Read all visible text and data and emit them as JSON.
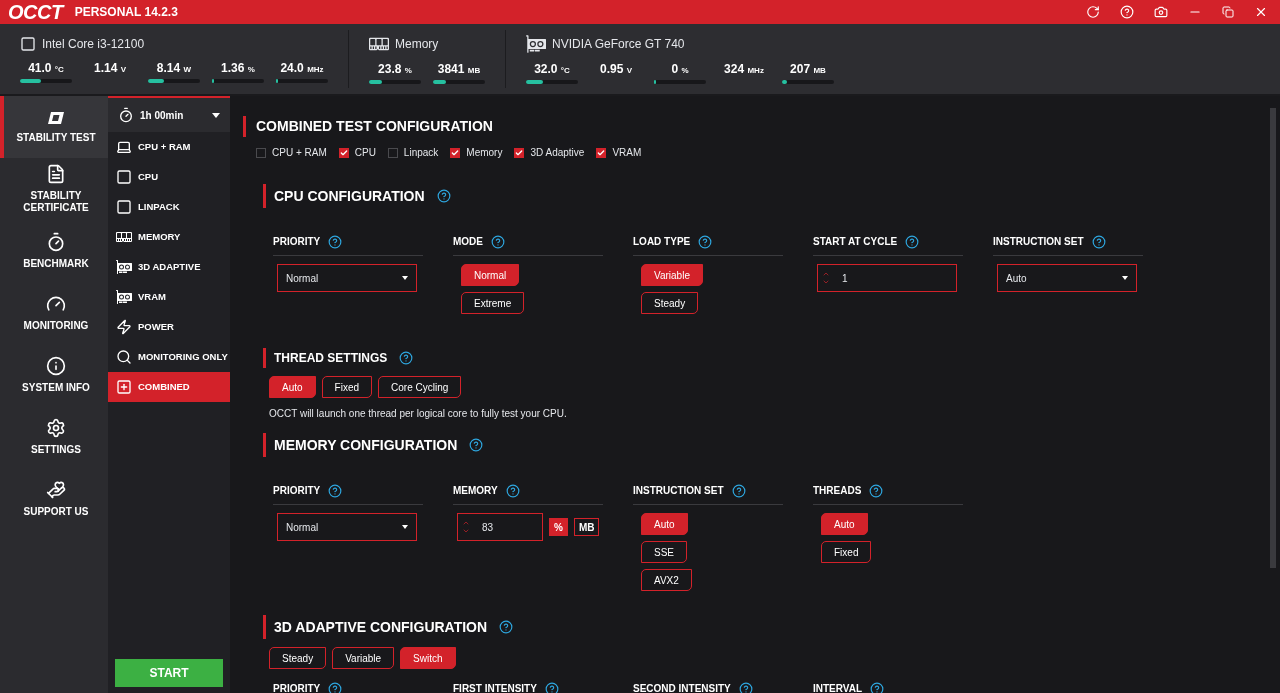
{
  "app": {
    "logo": "OCCT",
    "edition": "PERSONAL 14.2.3"
  },
  "monitors": [
    {
      "kind": "cpu",
      "name": "Intel Core i3-12100",
      "readings": [
        {
          "value": "41.0",
          "unit": "°C",
          "level": 0.41
        },
        {
          "value": "1.14",
          "unit": "V"
        },
        {
          "value": "8.14",
          "unit": "W",
          "level": 0.3
        },
        {
          "value": "1.36",
          "unit": "%",
          "level": 0.03
        },
        {
          "value": "24.0",
          "unit": "MHz",
          "level": 0.02
        }
      ]
    },
    {
      "kind": "memory",
      "name": "Memory",
      "readings": [
        {
          "value": "23.8",
          "unit": "%",
          "level": 0.25
        },
        {
          "value": "3841",
          "unit": "MB",
          "level": 0.25
        }
      ]
    },
    {
      "kind": "gpu",
      "name": "NVIDIA GeForce GT 740",
      "readings": [
        {
          "value": "32.0",
          "unit": "°C",
          "level": 0.32
        },
        {
          "value": "0.95",
          "unit": "V"
        },
        {
          "value": "0",
          "unit": "%",
          "level": 0
        },
        {
          "value": "324",
          "unit": "MHz"
        },
        {
          "value": "207",
          "unit": "MB",
          "level": 0.1
        }
      ]
    }
  ],
  "nav": [
    {
      "kind": "stability",
      "label": "STABILITY TEST",
      "selected": true
    },
    {
      "kind": "certificate",
      "label": "STABILITY CERTIFICATE",
      "selected": false
    },
    {
      "kind": "benchmark",
      "label": "BENCHMARK",
      "selected": false
    },
    {
      "kind": "monitoring",
      "label": "MONITORING",
      "selected": false
    },
    {
      "kind": "info",
      "label": "SYSTEM INFO",
      "selected": false
    },
    {
      "kind": "settings",
      "label": "SETTINGS",
      "selected": false
    },
    {
      "kind": "support",
      "label": "SUPPORT US",
      "selected": false
    }
  ],
  "duration": "1h 00min",
  "tests": [
    {
      "kind": "cpu_ram",
      "label": "CPU + RAM",
      "selected": false
    },
    {
      "kind": "cpu",
      "label": "CPU",
      "selected": false
    },
    {
      "kind": "cpu",
      "label": "LINPACK",
      "selected": false
    },
    {
      "kind": "memory",
      "label": "MEMORY",
      "selected": false
    },
    {
      "kind": "gpu",
      "label": "3D ADAPTIVE",
      "selected": false
    },
    {
      "kind": "gpu",
      "label": "VRAM",
      "selected": false
    },
    {
      "kind": "power",
      "label": "POWER",
      "selected": false
    },
    {
      "kind": "monitoring",
      "label": "MONITORING ONLY",
      "selected": false
    },
    {
      "kind": "combined",
      "label": "COMBINED",
      "selected": true
    }
  ],
  "start": "START",
  "combined": {
    "title": "COMBINED TEST CONFIGURATION",
    "checks": [
      {
        "label": "CPU + RAM",
        "checked": false
      },
      {
        "label": "CPU",
        "checked": true
      },
      {
        "label": "Linpack",
        "checked": false
      },
      {
        "label": "Memory",
        "checked": true
      },
      {
        "label": "3D Adaptive",
        "checked": true
      },
      {
        "label": "VRAM",
        "checked": true
      }
    ]
  },
  "sections": [
    {
      "title": "CPU CONFIGURATION",
      "fields": [
        {
          "kind": "select",
          "label": "PRIORITY",
          "value": "Normal"
        },
        {
          "kind": "options",
          "label": "MODE",
          "options": [
            {
              "label": "Normal",
              "selected": true
            },
            {
              "label": "Extreme",
              "selected": false
            }
          ]
        },
        {
          "kind": "options",
          "label": "LOAD TYPE",
          "options": [
            {
              "label": "Variable",
              "selected": true
            },
            {
              "label": "Steady",
              "selected": false
            }
          ]
        },
        {
          "kind": "spin",
          "label": "START AT CYCLE",
          "value": "1"
        },
        {
          "kind": "select",
          "label": "INSTRUCTION SET",
          "value": "Auto"
        }
      ],
      "sub": {
        "title": "THREAD SETTINGS",
        "options": [
          {
            "label": "Auto",
            "selected": true
          },
          {
            "label": "Fixed",
            "selected": false
          },
          {
            "label": "Core Cycling",
            "selected": false
          }
        ],
        "note": "OCCT will launch one thread per logical core to fully test your CPU."
      }
    },
    {
      "title": "MEMORY CONFIGURATION",
      "fields": [
        {
          "kind": "select",
          "label": "PRIORITY",
          "value": "Normal"
        },
        {
          "kind": "spin",
          "label": "MEMORY",
          "value": "83",
          "units": [
            {
              "label": "%",
              "selected": true
            },
            {
              "label": "MB",
              "selected": false
            }
          ]
        },
        {
          "kind": "options",
          "label": "INSTRUCTION SET",
          "options": [
            {
              "label": "Auto",
              "selected": true
            },
            {
              "label": "SSE",
              "selected": false
            },
            {
              "label": "AVX2",
              "selected": false
            }
          ]
        },
        {
          "kind": "options",
          "label": "THREADS",
          "options": [
            {
              "label": "Auto",
              "selected": true
            },
            {
              "label": "Fixed",
              "selected": false
            }
          ]
        }
      ]
    },
    {
      "title": "3D ADAPTIVE CONFIGURATION",
      "options": [
        {
          "label": "Steady",
          "selected": false
        },
        {
          "label": "Variable",
          "selected": false
        },
        {
          "label": "Switch",
          "selected": true
        }
      ],
      "fields": [
        {
          "kind": "blank",
          "label": "PRIORITY"
        },
        {
          "kind": "blank",
          "label": "FIRST INTENSITY"
        },
        {
          "kind": "blank",
          "label": "SECOND INTENSITY"
        },
        {
          "kind": "blank",
          "label": "INTERVAL"
        }
      ]
    }
  ]
}
